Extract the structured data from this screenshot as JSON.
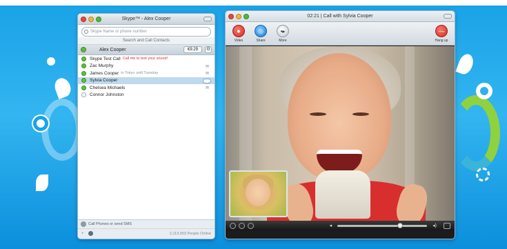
{
  "page": {
    "top_caption": "",
    "background_color": "#1aa3e8"
  },
  "contacts_window": {
    "title": "Skype™ - Alex Cooper",
    "search_placeholder": "Skype Name or phone number",
    "search_caption": "Search and Call Contacts",
    "me": {
      "name": "Alex Cooper",
      "status": "online",
      "credit": "€9.29"
    },
    "contacts": [
      {
        "name": "Skype Test Call",
        "mood": "Call me to test your sound!",
        "mood_color": "red",
        "status": "online",
        "selected": false,
        "badge": ""
      },
      {
        "name": "Zac Murphy",
        "mood": "",
        "mood_color": "",
        "status": "online",
        "selected": false,
        "badge": "✉"
      },
      {
        "name": "James Cooper",
        "mood": "in Tokyo until Tuesday",
        "mood_color": "",
        "status": "online",
        "selected": false,
        "badge": "✉"
      },
      {
        "name": "Sylvia Cooper",
        "mood": "",
        "mood_color": "",
        "status": "online",
        "selected": true,
        "badge": ""
      },
      {
        "name": "Chelsea Michaels",
        "mood": "",
        "mood_color": "",
        "status": "online",
        "selected": false,
        "badge": "✉"
      },
      {
        "name": "Connor Johnston",
        "mood": "",
        "mood_color": "",
        "status": "offline",
        "selected": false,
        "badge": ""
      }
    ],
    "call_phones_label": "Call Phones or send SMS",
    "online_count": "2,113,003 People Online"
  },
  "call_window": {
    "title": "02:21 | Call with Sylvia Cooper",
    "toolbar": {
      "video_label": "Video",
      "share_label": "Share",
      "more_label": "More",
      "hangup_label": "Hang up"
    },
    "volume_level": 0.7
  }
}
